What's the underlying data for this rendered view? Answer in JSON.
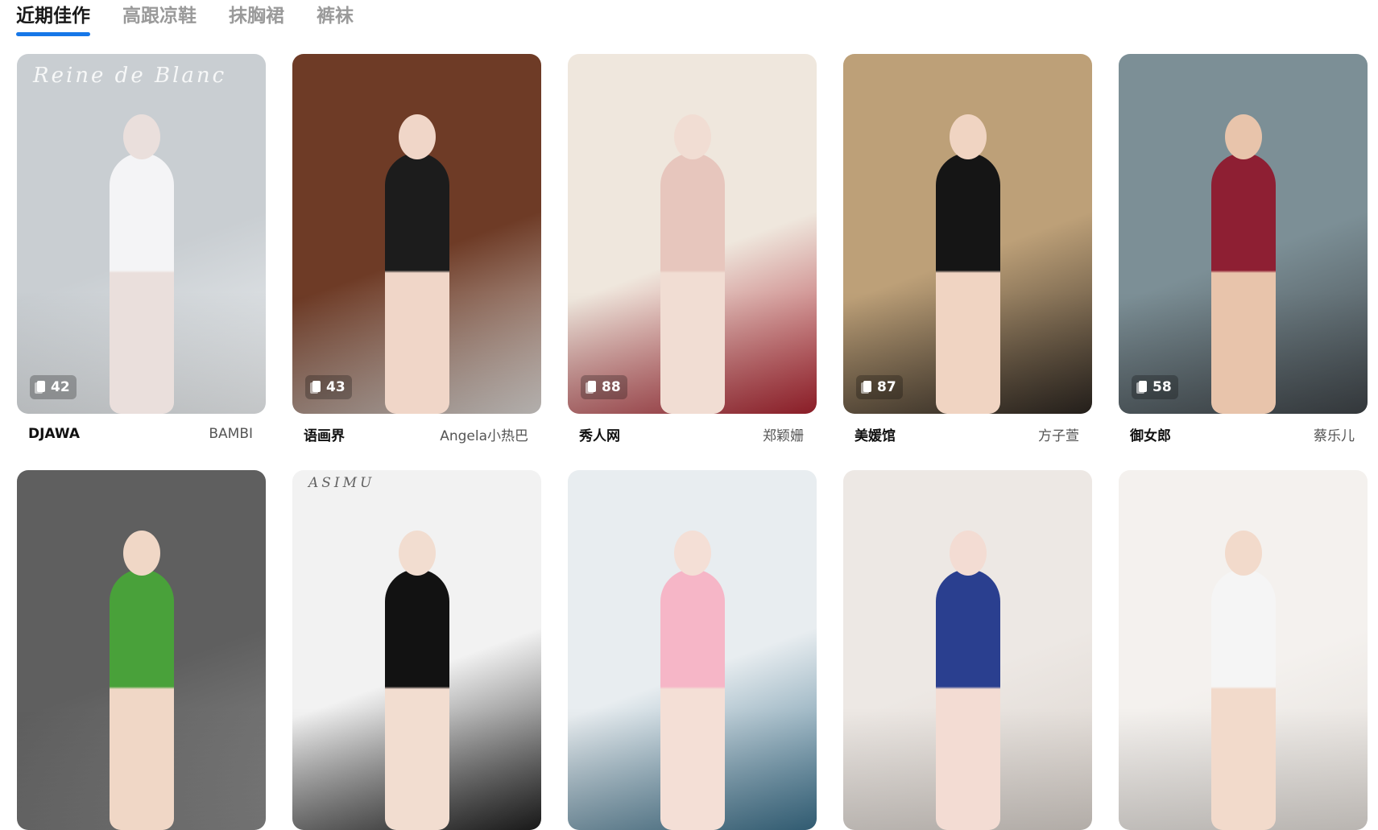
{
  "tabs": [
    {
      "label": "近期佳作",
      "active": true
    },
    {
      "label": "高跟凉鞋",
      "active": false
    },
    {
      "label": "抹胸裙",
      "active": false
    },
    {
      "label": "裤袜",
      "active": false
    }
  ],
  "accent_color": "#1677e8",
  "cards": [
    {
      "site": "DJAWA",
      "model": "BAMBI",
      "count": "42",
      "watermark": "Reine de Blanc",
      "bg": "#c9ced2",
      "bg2": "#eef1f3",
      "skin": "#eadfdc",
      "outfit": "#f4f4f6"
    },
    {
      "site": "语画界",
      "model": "Angela小热巴",
      "count": "43",
      "watermark": "",
      "bg": "#6e3b26",
      "bg2": "#d9d5d2",
      "skin": "#f0d6c8",
      "outfit": "#1c1c1c"
    },
    {
      "site": "秀人网",
      "model": "郑颖姗",
      "count": "88",
      "watermark": "",
      "bg": "#efe7dd",
      "bg2": "#a8232f",
      "skin": "#f1ddd3",
      "outfit": "#e7c6bd"
    },
    {
      "site": "美媛馆",
      "model": "方子萱",
      "count": "87",
      "watermark": "",
      "bg": "#bda078",
      "bg2": "#2b2520",
      "skin": "#f0d4c2",
      "outfit": "#151515"
    },
    {
      "site": "御女郎",
      "model": "蔡乐儿",
      "count": "58",
      "watermark": "",
      "bg": "#7c8f96",
      "bg2": "#3e4347",
      "skin": "#e8c4ab",
      "outfit": "#8e1f33"
    },
    {
      "site": "",
      "model": "",
      "count": "",
      "watermark": "",
      "bg": "#5f5f5f",
      "bg2": "#8a8a8a",
      "skin": "#f0d7c6",
      "outfit": "#49a13a"
    },
    {
      "site": "",
      "model": "",
      "count": "",
      "watermark": "ASIMU",
      "bg": "#f2f2f2",
      "bg2": "#1e1e1e",
      "skin": "#f2ddd0",
      "outfit": "#121212"
    },
    {
      "site": "",
      "model": "",
      "count": "",
      "watermark": "",
      "bg": "#e8edf0",
      "bg2": "#3b6f8a",
      "skin": "#f4dfd6",
      "outfit": "#f6b6c7"
    },
    {
      "site": "",
      "model": "",
      "count": "",
      "watermark": "",
      "bg": "#ede8e4",
      "bg2": "#d9d2cc",
      "skin": "#f3dcd3",
      "outfit": "#2a3f8f"
    },
    {
      "site": "",
      "model": "",
      "count": "",
      "watermark": "",
      "bg": "#f4f1ee",
      "bg2": "#e2ddd8",
      "skin": "#f2dacb",
      "outfit": "#f5f5f5"
    }
  ]
}
